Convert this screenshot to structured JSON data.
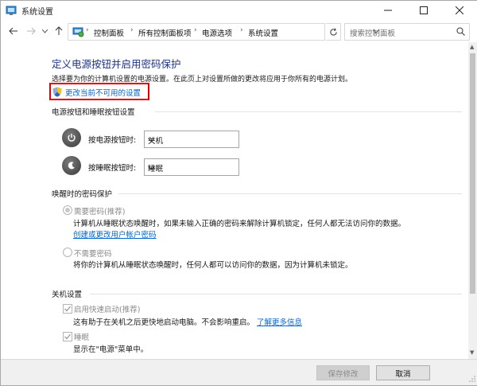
{
  "window": {
    "title": "系统设置"
  },
  "address_bar": {
    "crumbs": [
      "控制面板",
      "所有控制面板项",
      "电源选项",
      "系统设置"
    ],
    "search_placeholder": "搜索控制面板"
  },
  "main": {
    "title": "定义电源按钮并启用密码保护",
    "subtitle": "选择要为你的计算机设置的电源设置。在此页上对设置所做的更改将应用于你所有的电源计划。",
    "change_link": "更改当前不可用的设置",
    "power_section": {
      "heading": "电源按钮和睡眠按钮设置",
      "rows": [
        {
          "label": "按电源按钮时:",
          "value": "关机"
        },
        {
          "label": "按睡眠按钮时:",
          "value": "睡眠"
        }
      ]
    },
    "wake_section": {
      "heading": "唤醒时的密码保护",
      "require_label": "需要密码(推荐)",
      "require_desc": "计算机从睡眠状态唤醒时，如果未输入正确的密码来解除计算机锁定，任何人都无法访问你的数据。",
      "require_link": "创建或更改用户帐户密码",
      "norequire_label": "不需要密码",
      "norequire_desc": "将你的计算机从睡眠状态唤醒时，任何人都可以访问你的数据，因为计算机未锁定。"
    },
    "shutdown_section": {
      "heading": "关机设置",
      "fast_label": "启用快速启动(推荐)",
      "fast_desc": "这有助于在关机之后更快地启动电脑。不会影响重启。",
      "fast_link": "了解更多信息",
      "sleep_label": "睡眠",
      "sleep_desc": "显示在\"电源\"菜单中。"
    }
  },
  "footer": {
    "save_label": "保存修改",
    "cancel_label": "取消"
  },
  "colors": {
    "title": "#1e3287",
    "link": "#0066cc",
    "highlight_box": "#e00000"
  }
}
